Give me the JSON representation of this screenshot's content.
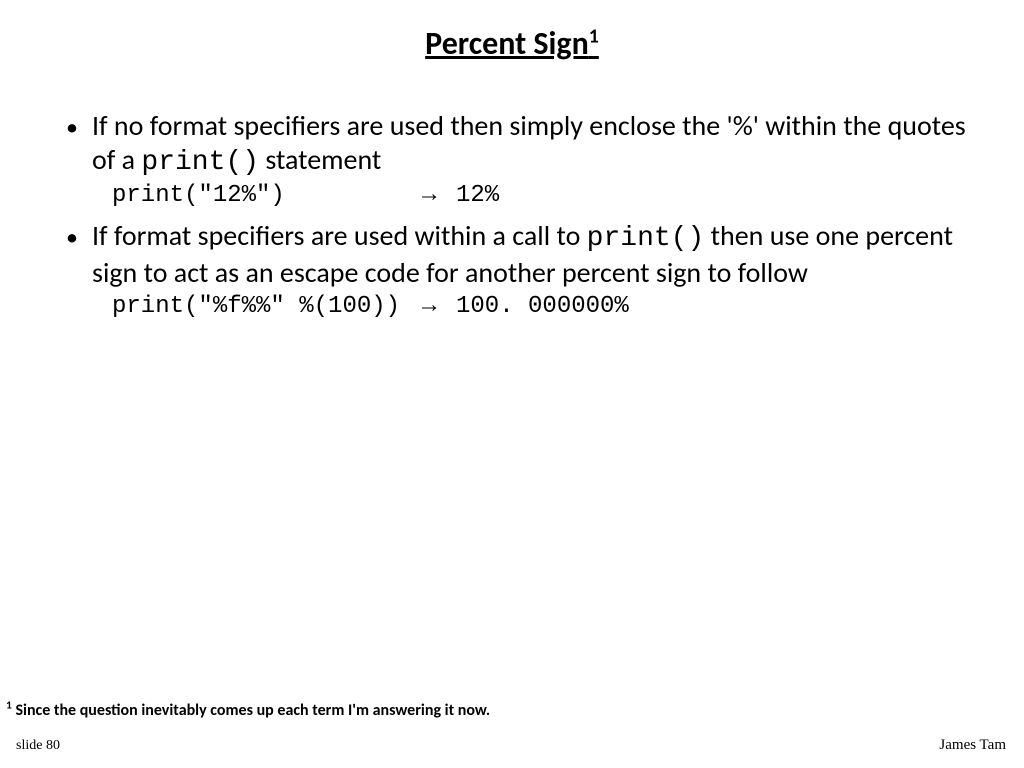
{
  "title": {
    "text": "Percent Sign",
    "sup": "1"
  },
  "bullets": [
    {
      "pre": "If no format specifiers are used then simply enclose the '%' within the quotes of a ",
      "code": "print()",
      "post": " statement"
    },
    {
      "pre": "If format specifiers are used within a call to ",
      "code": "print()",
      "post": " then use one percent sign to act as an escape code for another percent sign to follow"
    }
  ],
  "examples": [
    {
      "code": "print(\"12%\")",
      "arrow": "→",
      "output": "12%"
    },
    {
      "code": "print(\"%f%%\" %(100))",
      "arrow": "→",
      "output": "100. 000000%"
    }
  ],
  "footnote": {
    "marker": "1",
    "text": " Since the question inevitably comes up each term I'm answering it now."
  },
  "slide_number": "slide 80",
  "author": "James Tam"
}
